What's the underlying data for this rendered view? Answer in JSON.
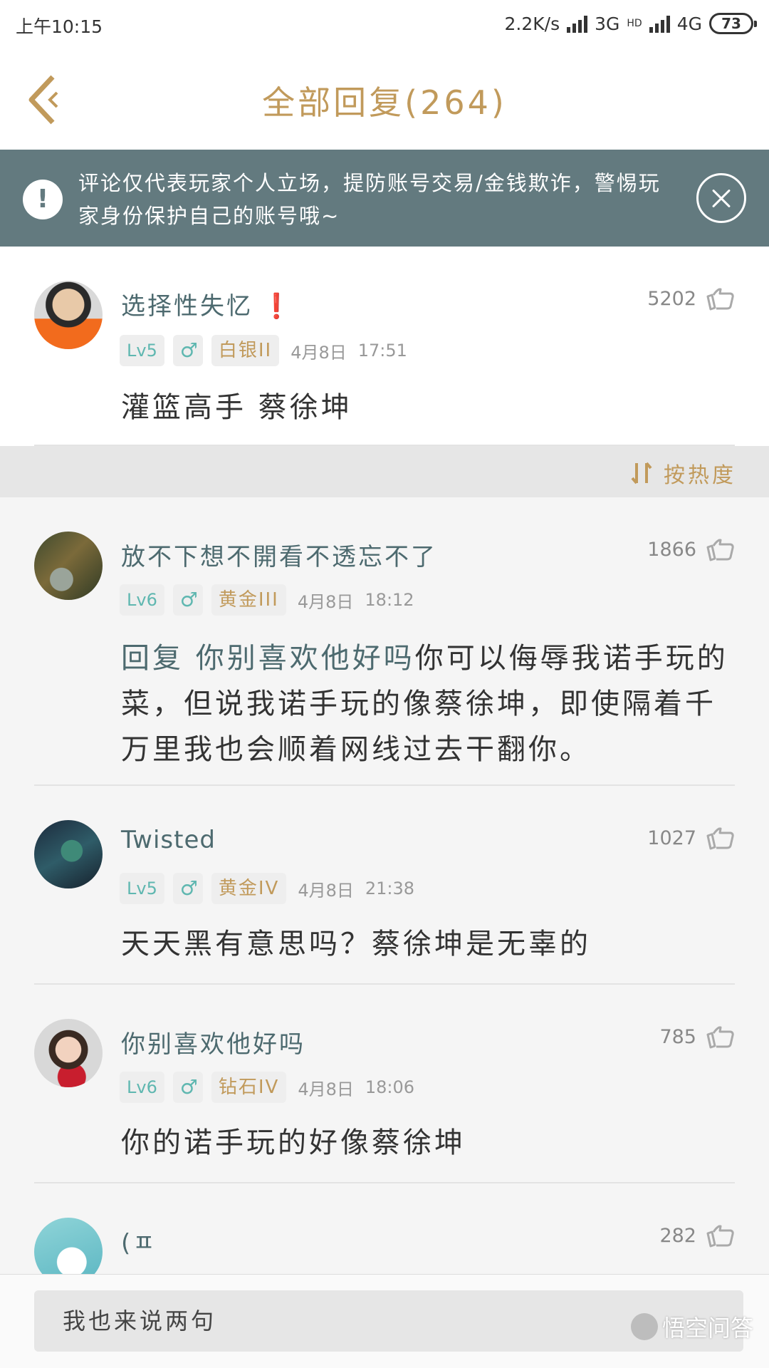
{
  "status_bar": {
    "time": "上午10:15",
    "net_speed": "2.2K/s",
    "network_3g": "3G",
    "network_4g": "4G",
    "hd_label": "HD",
    "battery": "73"
  },
  "header": {
    "title": "全部回复(264)"
  },
  "notice": {
    "text": "评论仅代表玩家个人立场，提防账号交易/金钱欺诈，警惕玩家身份保护自己的账号哦~",
    "icon_text": "!"
  },
  "pinned_comment": {
    "username": "选择性失忆",
    "badge": "❗",
    "likes": "5202",
    "level": "Lv5",
    "gender": "♂",
    "rank": "白银II",
    "date": "4月8日",
    "time": "17:51",
    "content": "灌篮高手 蔡徐坤"
  },
  "sort": {
    "label": "按热度"
  },
  "comments": [
    {
      "username": "放不下想不開看不透忘不了",
      "likes": "1866",
      "level": "Lv6",
      "gender": "♂",
      "rank": "黄金III",
      "date": "4月8日",
      "time": "18:12",
      "reply_prefix": "回复 你别喜欢他好吗",
      "content": "你可以侮辱我诺手玩的菜，但说我诺手玩的像蔡徐坤，即使隔着千万里我也会顺着网线过去干翻你。"
    },
    {
      "username": "Twisted",
      "likes": "1027",
      "level": "Lv5",
      "gender": "♂",
      "rank": "黄金IV",
      "date": "4月8日",
      "time": "21:38",
      "reply_prefix": "",
      "content": "天天黑有意思吗？蔡徐坤是无辜的"
    },
    {
      "username": "你别喜欢他好吗",
      "likes": "785",
      "level": "Lv6",
      "gender": "♂",
      "rank": "钻石IV",
      "date": "4月8日",
      "time": "18:06",
      "reply_prefix": "",
      "content": "你的诺手玩的好像蔡徐坤"
    },
    {
      "username": "(ㅍ",
      "likes": "282"
    }
  ],
  "input": {
    "placeholder": "我也来说两句"
  },
  "watermark": {
    "text": "悟空问答"
  },
  "colors": {
    "accent_gold": "#c19a5b",
    "name_teal": "#4d6a6f",
    "notice_bg": "#637a7f",
    "level_teal": "#5fb7b0"
  }
}
